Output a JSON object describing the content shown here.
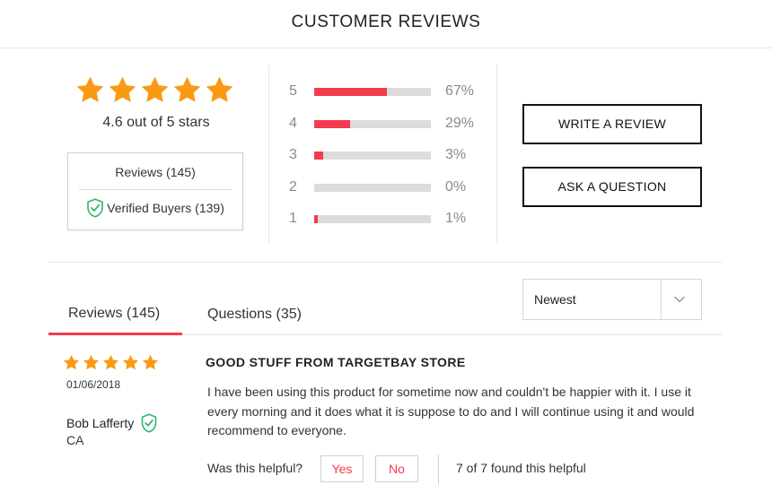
{
  "header": {
    "title": "CUSTOMER REVIEWS"
  },
  "summary": {
    "rating_stars": 5,
    "average_text": "4.6 out of 5 stars",
    "reviews_count_label": "Reviews (145)",
    "verified_label": "Verified Buyers (139)"
  },
  "distribution": [
    {
      "stars": "5",
      "percent_label": "67%",
      "fill_fraction": 0.62
    },
    {
      "stars": "4",
      "percent_label": "29%",
      "fill_fraction": 0.31
    },
    {
      "stars": "3",
      "percent_label": "3%",
      "fill_fraction": 0.08
    },
    {
      "stars": "2",
      "percent_label": "0%",
      "fill_fraction": 0.0
    },
    {
      "stars": "1",
      "percent_label": "1%",
      "fill_fraction": 0.03
    }
  ],
  "actions": {
    "write_review": "WRITE A REVIEW",
    "ask_question": "ASK A QUESTION"
  },
  "tabs": [
    {
      "label": "Reviews (145)",
      "active": true
    },
    {
      "label": "Questions (35)",
      "active": false
    }
  ],
  "sort": {
    "selected": "Newest"
  },
  "review": {
    "stars": 5,
    "date": "01/06/2018",
    "author": "Bob Lafferty",
    "location": "CA",
    "title": "GOOD STUFF FROM TARGETBAY STORE",
    "body": "I have been using this product for sometime now and couldn't be happier with it. I use it every morning and it does what it is suppose to do and I will continue using it and would recommend to everyone.",
    "helpful_question": "Was this helpful?",
    "yes_label": "Yes",
    "no_label": "No",
    "helpful_count": "7 of 7 found this helpful"
  },
  "colors": {
    "star": "#fa9a14",
    "accent": "#f43b4f",
    "verified": "#2fb56a",
    "bar_track": "#dcdcdc"
  },
  "icons": {
    "star": "star-icon",
    "verified": "verified-shield-icon",
    "dropdown": "chevron-down-icon"
  }
}
